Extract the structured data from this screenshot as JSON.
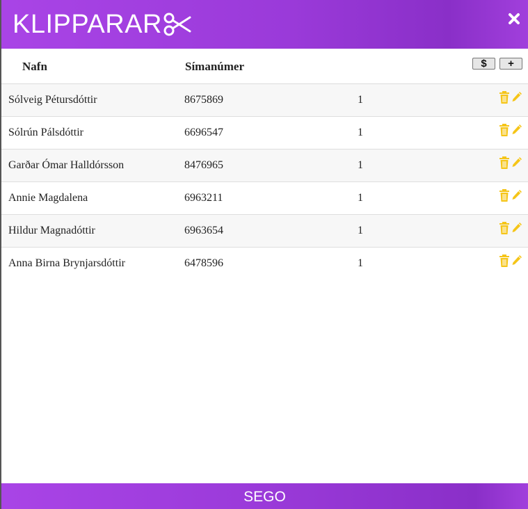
{
  "header": {
    "title": "KLIPPARAR",
    "title_icon": "scissors-icon",
    "close_glyph": "✖"
  },
  "table": {
    "columns": [
      "Nafn",
      "Símanúmer"
    ],
    "buttons": {
      "price": "$",
      "add": "+"
    },
    "rows": [
      {
        "name": "Sólveig Pétursdóttir",
        "phone": "8675869",
        "count": "1"
      },
      {
        "name": "Sólrún Pálsdóttir",
        "phone": "6696547",
        "count": "1"
      },
      {
        "name": "Garðar Ómar Halldórsson",
        "phone": "8476965",
        "count": "1"
      },
      {
        "name": "Annie Magdalena",
        "phone": "6963211",
        "count": "1"
      },
      {
        "name": "Hildur Magnadóttir",
        "phone": "6963654",
        "count": "1"
      },
      {
        "name": "Anna Birna Brynjarsdóttir",
        "phone": "6478596",
        "count": "1"
      }
    ]
  },
  "footer": {
    "text": "SEGO"
  },
  "colors": {
    "accent": "#9a3ad9",
    "icon": "#f5c518"
  }
}
